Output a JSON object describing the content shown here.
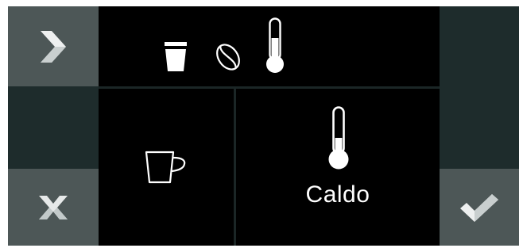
{
  "toolbar": {
    "next_icon": "chevron-right-icon",
    "cancel_icon": "close-icon",
    "confirm_icon": "checkmark-icon"
  },
  "header": {
    "icons": [
      "glass-icon",
      "coffee-bean-icon",
      "thermometer-icon"
    ]
  },
  "cup_option": {
    "icon": "cup-icon"
  },
  "temperature": {
    "icon": "thermometer-icon",
    "label": "Caldo"
  },
  "colors": {
    "panel": "#000000",
    "side_button": "#4d5757",
    "background": "#1e2c2c",
    "foreground": "#ffffff"
  }
}
